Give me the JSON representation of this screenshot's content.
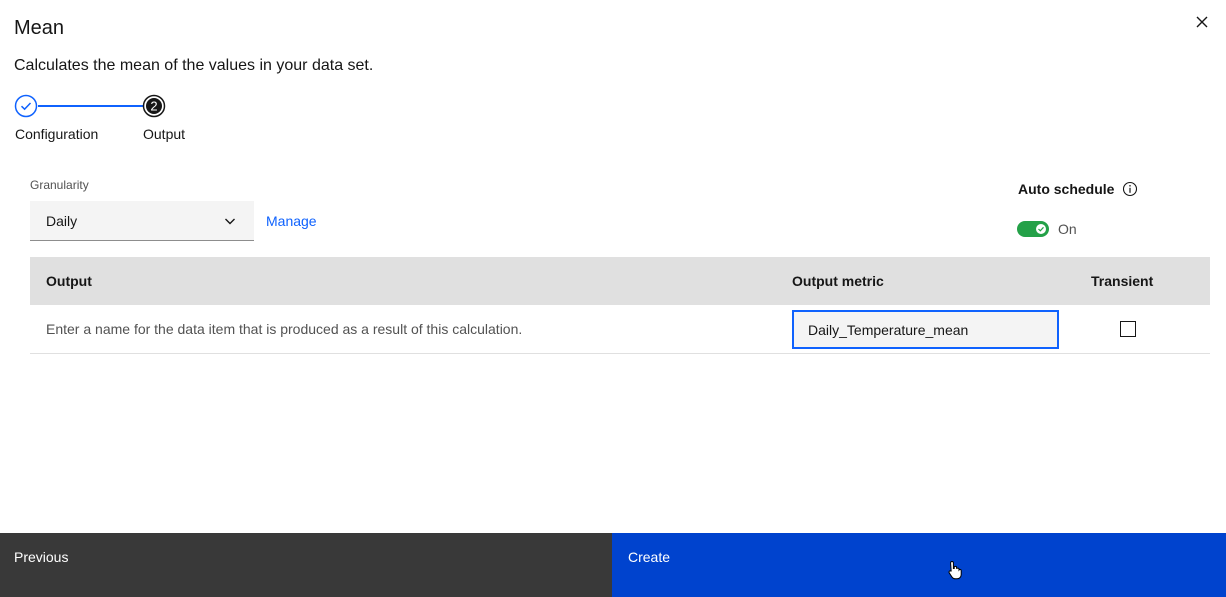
{
  "modal": {
    "title": "Mean",
    "description": "Calculates the mean of the values in your data set."
  },
  "progress": {
    "steps": [
      {
        "label": "Configuration",
        "state": "complete"
      },
      {
        "label": "Output",
        "state": "current",
        "number": "2"
      }
    ]
  },
  "granularity": {
    "label": "Granularity",
    "selected": "Daily",
    "manage_label": "Manage"
  },
  "auto_schedule": {
    "label": "Auto schedule",
    "state_label": "On",
    "enabled": true
  },
  "table": {
    "headers": {
      "output": "Output",
      "metric": "Output metric",
      "transient": "Transient"
    },
    "rows": [
      {
        "description": "Enter a name for the data item that is produced as a result of this calculation.",
        "metric_value": "Daily_Temperature_mean",
        "transient": false
      }
    ]
  },
  "footer": {
    "previous_label": "Previous",
    "create_label": "Create"
  },
  "colors": {
    "primary": "#0f62fe",
    "create_bg": "#0043ce",
    "secondary_bg": "#393939",
    "toggle_on": "#24a148"
  },
  "icons": [
    "close-icon",
    "checkmark-icon",
    "chevron-down-icon",
    "info-icon",
    "pointer-cursor-icon"
  ]
}
